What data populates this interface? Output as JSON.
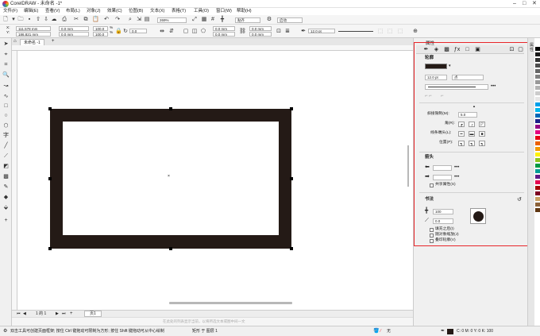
{
  "app": {
    "title": "CorelDRAW - 未命名 -1*"
  },
  "menu": [
    "文件(F)",
    "编辑(E)",
    "查看(V)",
    "布局(L)",
    "对象(J)",
    "效果(C)",
    "位图(B)",
    "文本(X)",
    "表格(T)",
    "工具(O)",
    "窗口(W)",
    "帮助(H)"
  ],
  "toolbar": {
    "zoom": "269%",
    "snap": "贴齐",
    "launch": "启动"
  },
  "propbar": {
    "x": "111.578 mm",
    "y": "186.821 mm",
    "w": "0.0 mm",
    "h": "0.0 mm",
    "sx": "100.0",
    "sy": "100.0",
    "pct": "%",
    "rotate": "0.0",
    "corner1": "0.0 mm",
    "corner2": "0.0 mm",
    "corner3": "0.0 mm",
    "corner4": "0.0 mm",
    "outline": "12.0 pt"
  },
  "document": {
    "tab": "未命名 -1",
    "page_tab": "页1",
    "page_counter": "1 的 1"
  },
  "canvas_hint": "在此处的列表显示当前，以将所选文本或图中间一文",
  "status": {
    "hint": "双击工具可创建页面框架; 按住 Ctrl 键拖动可限制为方形; 按住 Shift 键拖动可从中心绘制",
    "object": "矩形 于 图层 1",
    "fill": "无",
    "cmyk": "C: 0 M: 0 Y: 0 K: 100"
  },
  "properties": {
    "panel_title": "属性",
    "outline_header": "轮廓",
    "width": "12.0 pt",
    "unit": "点",
    "miter_label": "斜接限制(M):",
    "miter_value": "5.0",
    "corner_label": "角(R):",
    "linecap_label": "线条端头(L):",
    "position_label": "位置(P):",
    "arrow_header": "箭头",
    "share_attr": "共享属性(S)",
    "calligraphy_header": "书法",
    "nib_width": "100",
    "nib_angle": "0.0",
    "fill_behind": "填充之后(I)",
    "scale_image": "随对象缩放(J)",
    "overprint": "叠印轮廓(V)"
  },
  "colors": {
    "outline": "#241a16",
    "highlight": "#e8262a",
    "palette": [
      "#ffffff",
      "#000000",
      "#1a1a1a",
      "#333333",
      "#4d4d4d",
      "#666666",
      "#808080",
      "#999999",
      "#b3b3b3",
      "#cccccc",
      "#e6e6e6",
      "#00a0e9",
      "#00b7ee",
      "#0068b7",
      "#1d2088",
      "#920783",
      "#e4007f",
      "#e60012",
      "#eb6100",
      "#f39800",
      "#fff100",
      "#8fc31f",
      "#009944",
      "#009e96",
      "#601986",
      "#e5004f",
      "#a40000",
      "#7d0022",
      "#c9a063",
      "#8c6239",
      "#603813"
    ]
  }
}
